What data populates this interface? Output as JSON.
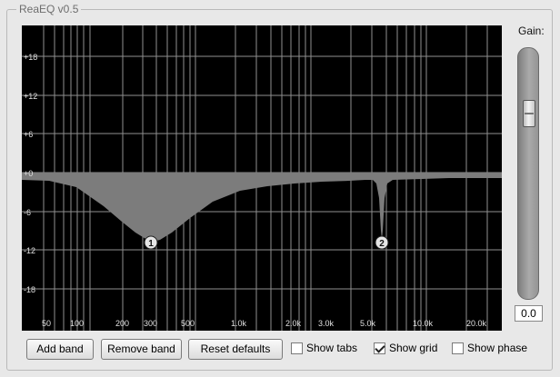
{
  "window": {
    "title": "ReaEQ v0.5"
  },
  "graph": {
    "db_labels": [
      "+18",
      "+12",
      "+6",
      "+0",
      "-6",
      "-12",
      "-18"
    ],
    "freq_labels": [
      "50",
      "100",
      "200",
      "300",
      "500",
      "1.0k",
      "2.0k",
      "3.0k",
      "5.0k",
      "10.0k",
      "20.0k"
    ],
    "bands": [
      {
        "label": "1",
        "freq_hz": 300,
        "gain_db": -10
      },
      {
        "label": "2",
        "freq_hz": 6100,
        "gain_db": -10
      }
    ],
    "colors": {
      "background": "#000000",
      "grid": "#8f8f8f",
      "curve_fill": "#7c7c7c",
      "handle": "#e6e6e6"
    }
  },
  "gain": {
    "label": "Gain:",
    "value": "0.0",
    "fader_level": 0.62
  },
  "buttons": {
    "add_band": "Add band",
    "remove_band": "Remove band",
    "reset_defaults": "Reset defaults"
  },
  "checkboxes": {
    "show_tabs": {
      "label": "Show tabs",
      "checked": false
    },
    "show_grid": {
      "label": "Show grid",
      "checked": true
    },
    "show_phase": {
      "label": "Show phase",
      "checked": false
    }
  }
}
